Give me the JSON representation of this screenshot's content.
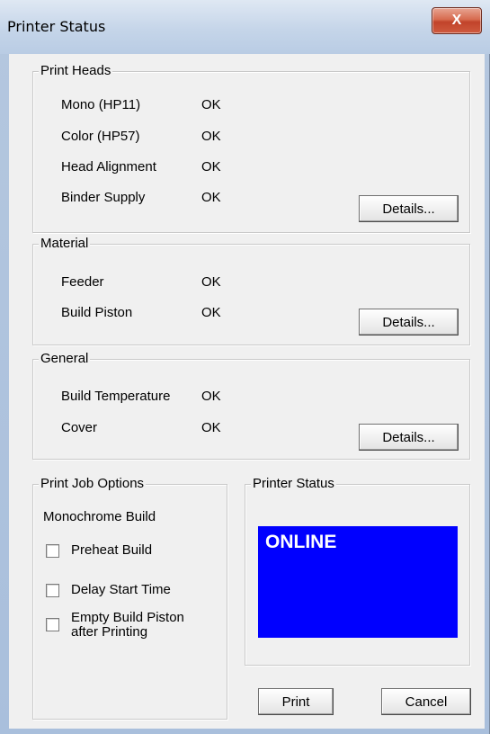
{
  "window": {
    "title": "Printer Status",
    "close_glyph": "X"
  },
  "print_heads": {
    "legend": "Print Heads",
    "rows": [
      {
        "label": "Mono (HP11)",
        "status": "OK"
      },
      {
        "label": "Color (HP57)",
        "status": "OK"
      },
      {
        "label": "Head Alignment",
        "status": "OK"
      },
      {
        "label": "Binder Supply",
        "status": "OK"
      }
    ],
    "details_label": "Details..."
  },
  "material": {
    "legend": "Material",
    "rows": [
      {
        "label": "Feeder",
        "status": "OK"
      },
      {
        "label": "Build Piston",
        "status": "OK"
      }
    ],
    "details_label": "Details..."
  },
  "general": {
    "legend": "General",
    "rows": [
      {
        "label": "Build Temperature",
        "status": "OK"
      },
      {
        "label": "Cover",
        "status": "OK"
      }
    ],
    "details_label": "Details..."
  },
  "job_options": {
    "legend": "Print Job Options",
    "mode_label": "Monochrome Build",
    "preheat_label": "Preheat Build",
    "preheat_checked": false,
    "delay_label": "Delay Start Time",
    "delay_checked": false,
    "empty_line1": "Empty Build Piston",
    "empty_line2": "after Printing",
    "empty_checked": false
  },
  "printer_status": {
    "legend": "Printer Status",
    "value": "ONLINE",
    "color": "#0000ff"
  },
  "actions": {
    "print_label": "Print",
    "cancel_label": "Cancel"
  }
}
